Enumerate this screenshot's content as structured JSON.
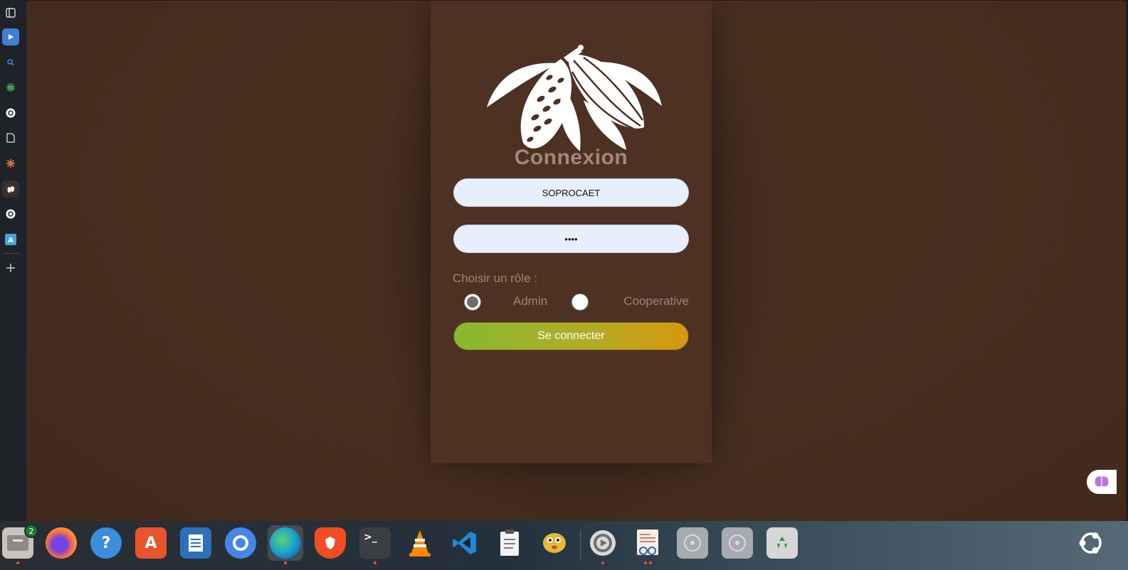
{
  "login": {
    "title": "Connexion",
    "username_value": "SOPROCAET",
    "password_value": "••••",
    "role_label": "Choisir un rôle :",
    "roles": [
      {
        "label": "Admin",
        "checked": true
      },
      {
        "label": "Cooperative",
        "checked": false
      }
    ],
    "submit_label": "Se connecter"
  },
  "sidebar": {
    "items": [
      {
        "icon": "sidebar-toggle-icon"
      },
      {
        "icon": "play-icon"
      },
      {
        "icon": "search-icon"
      },
      {
        "icon": "whatsapp-icon"
      },
      {
        "icon": "openai-icon"
      },
      {
        "icon": "document-icon"
      },
      {
        "icon": "claude-icon"
      },
      {
        "icon": "cocoa-site-icon"
      },
      {
        "icon": "openai-icon"
      },
      {
        "icon": "translate-icon"
      },
      {
        "icon": "add-icon"
      }
    ]
  },
  "dock": {
    "files_badge": "2",
    "apps": [
      "files",
      "firefox",
      "help",
      "app-center",
      "writer",
      "chromium",
      "edge",
      "brave",
      "terminal",
      "vlc",
      "vscode",
      "notes",
      "blowfish",
      "settings",
      "document-viewer",
      "disc-1",
      "disc-2",
      "trash"
    ]
  },
  "colors": {
    "background": "#472f20",
    "card": "#4d3122",
    "title": "#a2887a",
    "button_start": "#86b92e",
    "button_end": "#d6980f"
  }
}
